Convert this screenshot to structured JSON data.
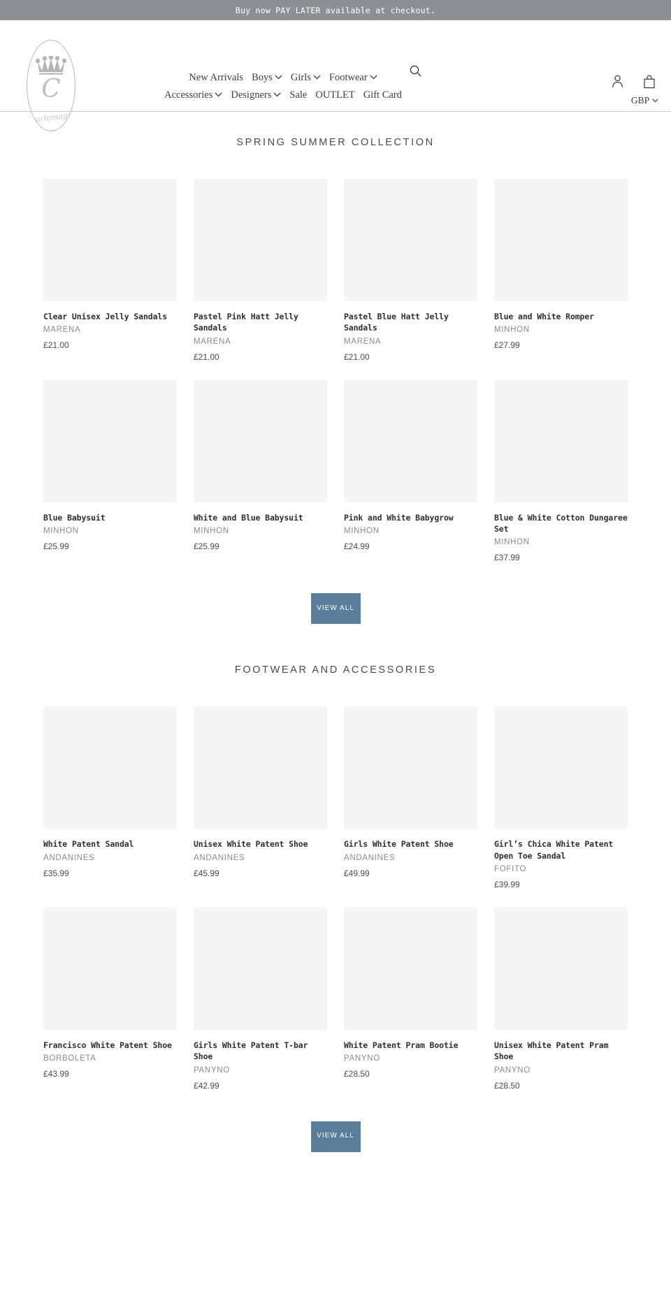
{
  "announcement": {
    "text": "Buy now PAY LATER available at checkout."
  },
  "header": {
    "logo": {
      "letter": "C",
      "script": "Charlemagne",
      "alt": "Charlemagne logo"
    },
    "nav": [
      {
        "label": "New Arrivals",
        "has_dropdown": false
      },
      {
        "label": "Boys",
        "has_dropdown": true
      },
      {
        "label": "Girls",
        "has_dropdown": true
      },
      {
        "label": "Footwear",
        "has_dropdown": true
      },
      {
        "label": "Accessories",
        "has_dropdown": true
      },
      {
        "label": "Designers",
        "has_dropdown": true
      },
      {
        "label": "Sale",
        "has_dropdown": false
      },
      {
        "label": "OUTLET",
        "has_dropdown": false
      },
      {
        "label": "Gift Card",
        "has_dropdown": false
      }
    ],
    "icons": {
      "search": "search-icon",
      "account": "account-icon",
      "cart": "shopping-bag-icon"
    },
    "currency": "GBP"
  },
  "sections": [
    {
      "title": "SPRING SUMMER COLLECTION",
      "view_all": "VIEW ALL",
      "products": [
        {
          "title": "Clear Unisex Jelly Sandals",
          "vendor": "MARENA",
          "price": "£21.00"
        },
        {
          "title": "Pastel Pink Hatt Jelly Sandals",
          "vendor": "MARENA",
          "price": "£21.00"
        },
        {
          "title": "Pastel Blue Hatt Jelly Sandals",
          "vendor": "MARENA",
          "price": "£21.00"
        },
        {
          "title": "Blue and White Romper",
          "vendor": "MINHON",
          "price": "£27.99"
        },
        {
          "title": "Blue Babysuit",
          "vendor": "MINHON",
          "price": "£25.99"
        },
        {
          "title": "White and Blue Babysuit",
          "vendor": "MINHON",
          "price": "£25.99"
        },
        {
          "title": "Pink and White Babygrow",
          "vendor": "MINHON",
          "price": "£24.99"
        },
        {
          "title": "Blue & White Cotton Dungaree Set",
          "vendor": "MINHON",
          "price": "£37.99"
        }
      ]
    },
    {
      "title": "FOOTWEAR AND ACCESSORIES",
      "view_all": "VIEW ALL",
      "products": [
        {
          "title": "White Patent Sandal",
          "vendor": "ANDANINES",
          "price": "£35.99"
        },
        {
          "title": "Unisex White Patent Shoe",
          "vendor": "ANDANINES",
          "price": "£45.99"
        },
        {
          "title": "Girls White Patent Shoe",
          "vendor": "ANDANINES",
          "price": "£49.99"
        },
        {
          "title": "Girl’s Chica White Patent Open Toe Sandal",
          "vendor": "FOFITO",
          "price": "£39.99"
        },
        {
          "title": "Francisco White Patent Shoe",
          "vendor": "BORBOLETA",
          "price": "£43.99"
        },
        {
          "title": "Girls White Patent T-bar Shoe",
          "vendor": "PANYNO",
          "price": "£42.99"
        },
        {
          "title": "White Patent Pram Bootie",
          "vendor": "PANYNO",
          "price": "£28.50"
        },
        {
          "title": "Unisex White Patent Pram Shoe",
          "vendor": "PANYNO",
          "price": "£28.50"
        }
      ]
    }
  ],
  "colors": {
    "announcement_bg": "#8d9093",
    "button_bg": "#5a7d99",
    "image_placeholder": "#f5f5f5",
    "text": "#3a3a3a",
    "vendor_text": "#8a8a8a"
  }
}
